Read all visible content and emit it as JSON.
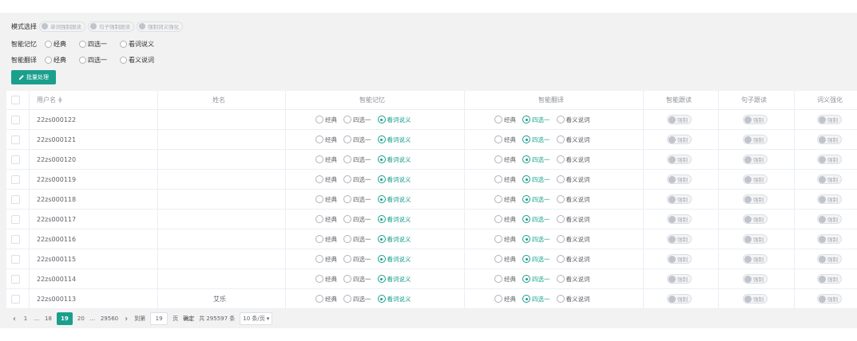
{
  "filters": {
    "mode": {
      "label": "模式选择",
      "options": [
        "单词强制跟读",
        "句子强制跟读",
        "强制词义强化"
      ]
    },
    "memory": {
      "label": "智能记忆",
      "options": [
        "经典",
        "四选一",
        "看词说义"
      ]
    },
    "translate": {
      "label": "智能翻译",
      "options": [
        "经典",
        "四选一",
        "看义说词"
      ]
    }
  },
  "batch_button": {
    "icon": "edit-icon",
    "label": "批量处理"
  },
  "table": {
    "headers": {
      "username": "用户名",
      "name": "姓名",
      "memory": "智能记忆",
      "translate": "智能翻译",
      "read_follow": "智能跟读",
      "sentence_follow": "句子跟读",
      "meaning": "词义强化"
    },
    "memory_options": [
      "经典",
      "四选一",
      "看词说义"
    ],
    "translate_options": [
      "经典",
      "四选一",
      "看义说词"
    ],
    "toggle_label": "强制",
    "rows": [
      {
        "username": "22zs000122",
        "name": "",
        "memory": 2,
        "translate": 1
      },
      {
        "username": "22zs000121",
        "name": "",
        "memory": 2,
        "translate": 1
      },
      {
        "username": "22zs000120",
        "name": "",
        "memory": 2,
        "translate": 1
      },
      {
        "username": "22zs000119",
        "name": "",
        "memory": 2,
        "translate": 1
      },
      {
        "username": "22zs000118",
        "name": "",
        "memory": 2,
        "translate": 1
      },
      {
        "username": "22zs000117",
        "name": "",
        "memory": 2,
        "translate": 1
      },
      {
        "username": "22zs000116",
        "name": "",
        "memory": 2,
        "translate": 1
      },
      {
        "username": "22zs000115",
        "name": "",
        "memory": 2,
        "translate": 1
      },
      {
        "username": "22zs000114",
        "name": "",
        "memory": 2,
        "translate": 1
      },
      {
        "username": "22zs000113",
        "name": "艾乐",
        "memory": 2,
        "translate": 1
      }
    ]
  },
  "pagination": {
    "prev_icon": "chevron-left-icon",
    "next_icon": "chevron-right-icon",
    "first": "1",
    "ellipsis": "...",
    "before": "18",
    "current": "19",
    "after": "20",
    "last": "29560",
    "goto_label": "到第",
    "goto_value": "19",
    "page_unit": "页",
    "confirm": "确定",
    "total": "共 295597 条",
    "page_size": "10 条/页"
  },
  "colors": {
    "accent": "#1a9f8d"
  }
}
